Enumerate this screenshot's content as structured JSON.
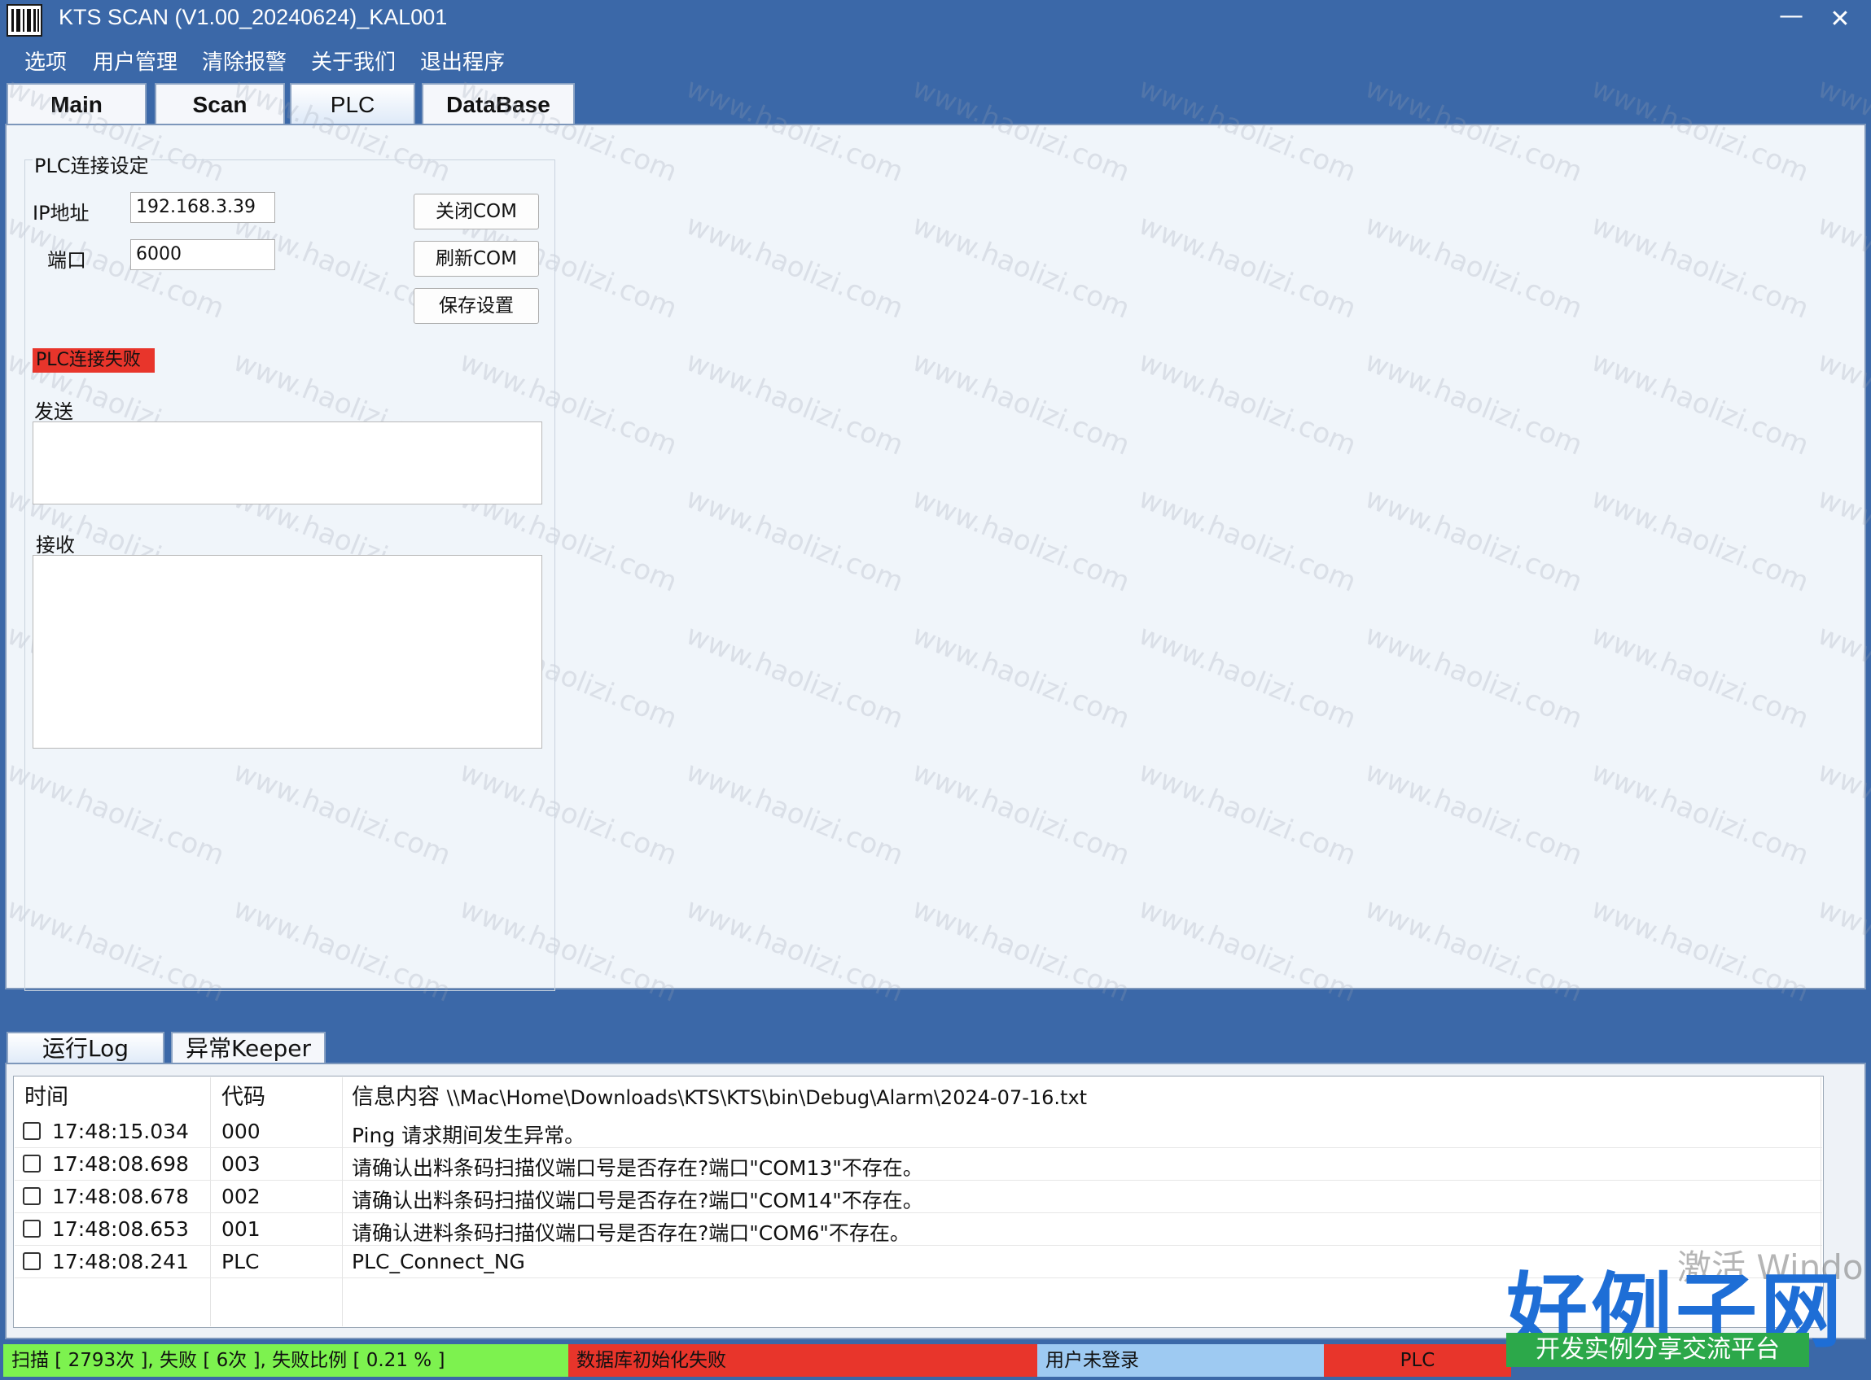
{
  "window": {
    "title": "KTS SCAN (V1.00_20240624)_KAL001",
    "minimize_glyph": "—",
    "close_glyph": "✕"
  },
  "menu": [
    "选项",
    "用户管理",
    "清除报警",
    "关于我们",
    "退出程序"
  ],
  "top_tabs": [
    "Main",
    "Scan",
    "PLC",
    "DataBase"
  ],
  "active_top_tab": "PLC",
  "plc": {
    "group_title": "PLC连接设定",
    "ip_label": "IP地址",
    "ip_value": "192.168.3.39",
    "port_label": "端口",
    "port_value": "6000",
    "btn_close_com": "关闭COM",
    "btn_refresh_com": "刷新COM",
    "btn_save": "保存设置",
    "status_text": "PLC连接失败",
    "status_color": "#e8352b",
    "send_label": "发送",
    "receive_label": "接收"
  },
  "bottom_tabs": [
    "运行Log",
    "异常Keeper"
  ],
  "log": {
    "columns": {
      "time": "时间",
      "code": "代码",
      "info": "信息内容",
      "path": "\\\\Mac\\Home\\Downloads\\KTS\\KTS\\bin\\Debug\\Alarm\\2024-07-16.txt"
    },
    "rows": [
      {
        "time": "17:48:15.034",
        "code": "000",
        "message": "Ping 请求期间发生异常。"
      },
      {
        "time": "17:48:08.698",
        "code": "003",
        "message": "请确认出料条码扫描仪端口号是否存在?端口\"COM13\"不存在。"
      },
      {
        "time": "17:48:08.678",
        "code": "002",
        "message": "请确认出料条码扫描仪端口号是否存在?端口\"COM14\"不存在。"
      },
      {
        "time": "17:48:08.653",
        "code": "001",
        "message": "请确认进料条码扫描仪端口号是否存在?端口\"COM6\"不存在。"
      },
      {
        "time": "17:48:08.241",
        "code": "PLC",
        "message": "PLC_Connect_NG"
      }
    ]
  },
  "statusbar": {
    "scan_stats": "扫描 [ 2793次 ], 失败 [ 6次 ], 失败比例 [ 0.21 % ]",
    "db_status": "数据库初始化失败",
    "user_status": "用户未登录",
    "plc_status": "PLC",
    "colors": {
      "green": "#7df24f",
      "red": "#e8352b",
      "blue": "#9ecaf2"
    }
  },
  "overlay": {
    "watermark": "www.haolizi.com",
    "brand_title": "好例子网",
    "brand_subtitle": "开发实例分享交流平台",
    "activation_hint": "激活 Windo"
  }
}
